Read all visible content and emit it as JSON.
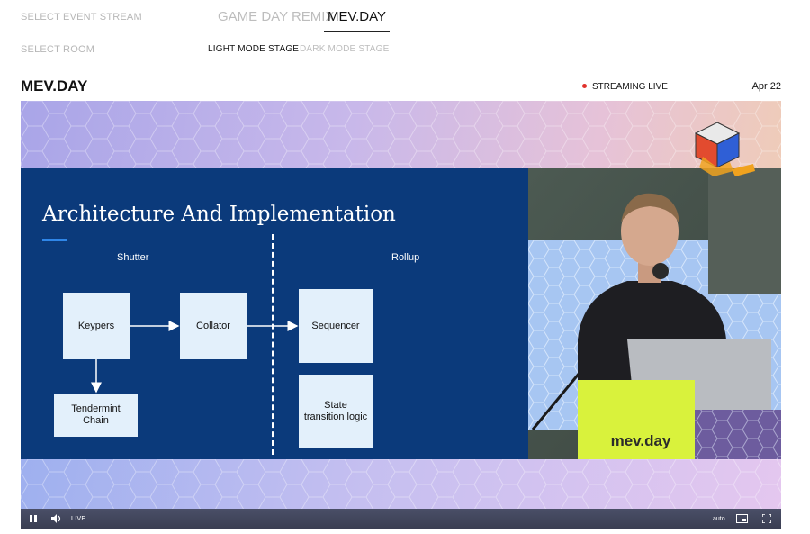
{
  "stream_selector": {
    "label": "SELECT EVENT STREAM",
    "tabs": [
      {
        "label": "GAME DAY REMIX",
        "active": false
      },
      {
        "label": "MEV.DAY",
        "active": true
      }
    ]
  },
  "room_selector": {
    "label": "SELECT ROOM",
    "rooms": [
      {
        "label": "LIGHT MODE STAGE",
        "active": true
      },
      {
        "label": "DARK MODE STAGE",
        "active": false
      }
    ]
  },
  "event": {
    "title": "MEV.DAY",
    "status": "STREAMING LIVE",
    "date": "Apr 22"
  },
  "slide": {
    "title": "Architecture And Implementation",
    "columns": {
      "left": "Shutter",
      "right": "Rollup"
    },
    "boxes": {
      "keypers": "Keypers",
      "collator": "Collator",
      "sequencer": "Sequencer",
      "tendermint_line1": "Tendermint",
      "tendermint_line2": "Chain",
      "state_line1": "State",
      "state_line2": "transition logic"
    }
  },
  "speaker": {
    "podium_label": "mev.day"
  },
  "player_controls": {
    "live_label": "LIVE",
    "quality": "auto",
    "icons": [
      "pause-icon",
      "volume-icon",
      "picture-in-picture-icon",
      "fullscreen-icon"
    ]
  },
  "colors": {
    "slide_background": "#0b3a7b",
    "diagram_box": "#e3f0fb",
    "live_dot": "#e0312b",
    "podium": "#d9f23c",
    "control_bar": "#3f4358"
  }
}
